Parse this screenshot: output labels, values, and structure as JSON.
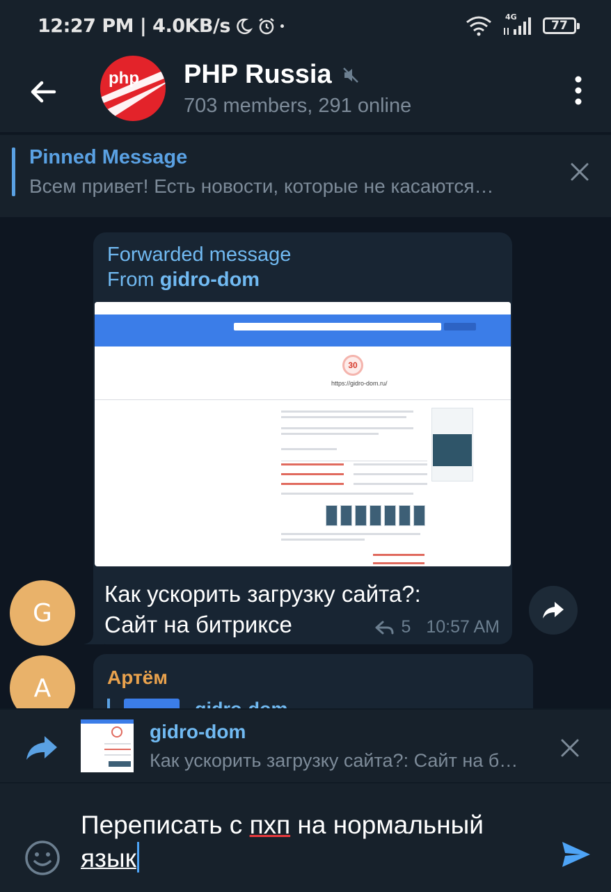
{
  "status_bar": {
    "time_speed": "12:27 PM | 4.0KB/s",
    "network_label": "4G",
    "battery": "77"
  },
  "header": {
    "title": "PHP Russia",
    "subtitle": "703 members, 291 online",
    "avatar_text": "php"
  },
  "pinned": {
    "title": "Pinned Message",
    "text": "Всем привет!  Есть новости, которые не касаются…"
  },
  "messages": [
    {
      "forwarded_label": "Forwarded message",
      "from_prefix": "From ",
      "from_name": "gidro-dom",
      "text_line1": "Как ускорить загрузку сайта?:",
      "text_line2": "Сайт на битриксе",
      "replies": "5",
      "time": "10:57 AM",
      "avatar_letter": "G"
    },
    {
      "sender": "Артём",
      "reply_name": "gidro-dom",
      "avatar_letter": "A"
    }
  ],
  "forward_preview": {
    "name": "gidro-dom",
    "text": "Как ускорить загрузку сайта?: Сайт на битриксе"
  },
  "composer": {
    "text_part1": "Переписать с ",
    "text_misspelled": "пхп",
    "text_part2": " на нормальный ",
    "text_underlined": "язык"
  },
  "colors": {
    "background": "#0e1621",
    "panel": "#17212b",
    "bubble": "#182533",
    "accent": "#5aa1e3",
    "link": "#71baf2",
    "avatar": "#e9b26a",
    "php_red": "#e3232a"
  }
}
